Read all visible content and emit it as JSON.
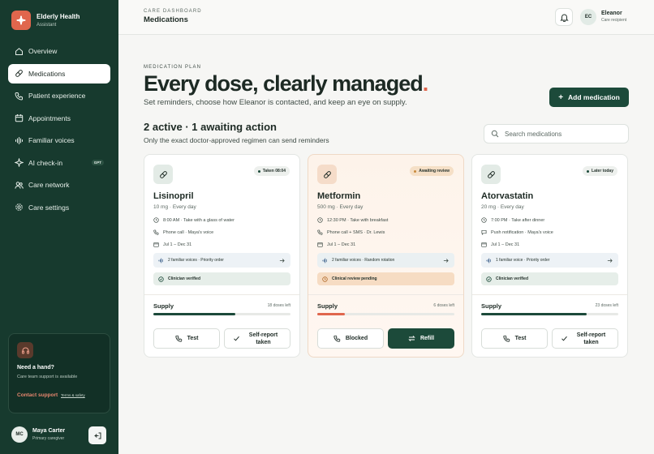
{
  "app": {
    "name": "Elderly Health",
    "subtitle": "Assistant"
  },
  "nav": [
    {
      "label": "Overview",
      "icon": "home-icon"
    },
    {
      "label": "Medications",
      "icon": "pill-icon",
      "active": true
    },
    {
      "label": "Patient experience",
      "icon": "phone-icon"
    },
    {
      "label": "Appointments",
      "icon": "calendar-icon"
    },
    {
      "label": "Familiar voices",
      "icon": "waveform-icon"
    },
    {
      "label": "AI check-in",
      "icon": "sparkle-icon",
      "badge": "GPT"
    },
    {
      "label": "Care network",
      "icon": "people-icon"
    },
    {
      "label": "Care settings",
      "icon": "gear-icon"
    }
  ],
  "help": {
    "title": "Need a hand?",
    "subtitle": "Care team support is available",
    "link": "Contact support",
    "terms": "Terms & safety"
  },
  "user": {
    "initials": "MC",
    "name": "Maya Carter",
    "role": "Primary caregiver"
  },
  "header": {
    "eyebrow": "CARE DASHBOARD",
    "title": "Medications",
    "recipient_initials": "EC",
    "recipient_name": "Eleanor",
    "recipient_role": "Care recipient"
  },
  "hero": {
    "eyebrow": "MEDICATION PLAN",
    "title": "Every dose, clearly managed",
    "title_dot": ".",
    "subtitle": "Set reminders, choose how Eleanor is contacted, and keep an eye on supply.",
    "add_label": "Add medication"
  },
  "status": {
    "headline": "2 active · 1 awaiting action",
    "subtitle": "Only the exact doctor-approved regimen can send reminders"
  },
  "search": {
    "placeholder": "Search medications"
  },
  "colors": {
    "sidebar": "#173a2e",
    "accent": "#e0664d",
    "primary": "#1c4a3a",
    "awaiting_bg": "#fdf3ea"
  },
  "supply_label": "Supply",
  "cards": [
    {
      "name": "Lisinopril",
      "dose": "10 mg · Every day",
      "badge": "Taken 08:04",
      "schedule": "8:00 AM · Take with a glass of water",
      "contact": "Phone call · Maya's voice",
      "dates": "Jul 1 – Dec 31",
      "voices": "2 familiar voices · Priority order",
      "verify": "Clinician verified",
      "doses": "18 doses left",
      "supply_pct": 0.6,
      "btn_left": "Test",
      "btn_right": "Self-report taken"
    },
    {
      "name": "Metformin",
      "dose": "500 mg · Every day",
      "badge": "Awaiting review",
      "schedule": "12:30 PM · Take with breakfast",
      "contact": "Phone call + SMS · Dr. Lewis",
      "dates": "Jul 1 – Dec 31",
      "voices": "2 familiar voices · Random rotation",
      "verify": "Clinical review pending",
      "doses": "6 doses left",
      "supply_pct": 0.2,
      "btn_left": "Blocked",
      "btn_right": "Refill"
    },
    {
      "name": "Atorvastatin",
      "dose": "20 mg · Every day",
      "badge": "Later today",
      "schedule": "7:00 PM · Take after dinner",
      "contact": "Push notification · Maya's voice",
      "dates": "Jul 1 – Dec 31",
      "voices": "1 familiar voice · Priority order",
      "verify": "Clinician verified",
      "doses": "23 doses left",
      "supply_pct": 0.77,
      "btn_left": "Test",
      "btn_right": "Self-report taken"
    }
  ]
}
